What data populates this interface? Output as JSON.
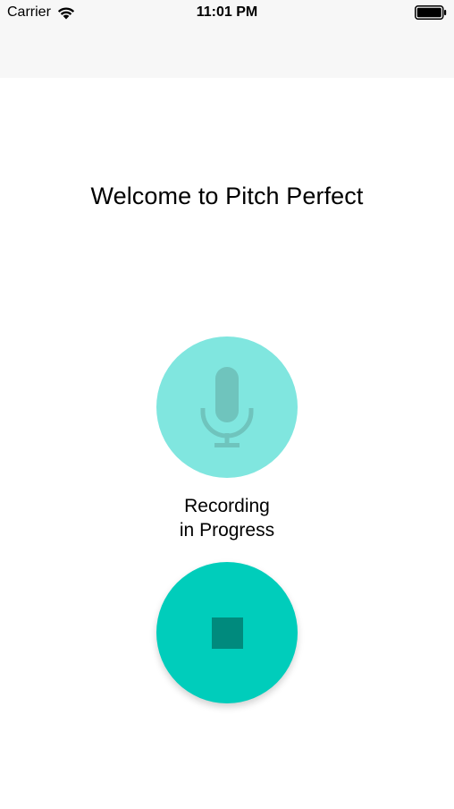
{
  "status_bar": {
    "carrier": "Carrier",
    "time": "11:01 PM",
    "wifi_icon": "wifi-icon",
    "battery_icon": "battery-icon"
  },
  "main": {
    "welcome_text": "Welcome to Pitch Perfect",
    "record_button": {
      "icon": "microphone-icon",
      "color": "#80e6df",
      "icon_color": "#6fc4bd",
      "enabled": false
    },
    "recording_label": {
      "line1": "Recording",
      "line2": "in Progress"
    },
    "stop_button": {
      "icon": "stop-icon",
      "color": "#00cdbb",
      "icon_color": "#008a7d",
      "enabled": true
    }
  }
}
